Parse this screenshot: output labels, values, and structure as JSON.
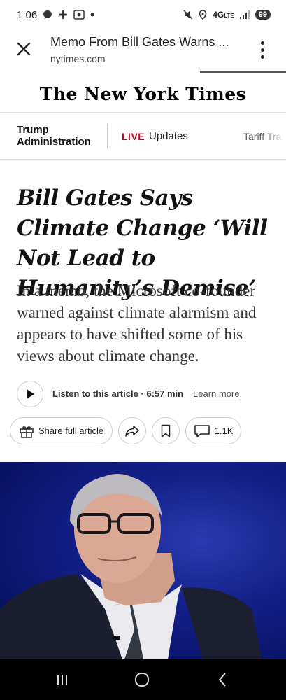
{
  "status_bar": {
    "time": "1:06",
    "network": "4G",
    "network_suffix": "LTE",
    "battery": "99"
  },
  "tab": {
    "title": "Memo From Bill Gates Warns ...",
    "url": "nytimes.com"
  },
  "logo": "The New York Times",
  "section_nav": {
    "topic": "Trump Administration",
    "live_badge": "LIVE",
    "live_label": "Updates",
    "next_item": "Tariff Tra"
  },
  "article": {
    "headline": "Bill Gates Says Climate Change ‘Will Not Lead to Humanity’s Demise’",
    "summary": "In a memo, the Microsoft co-founder warned against climate alarmism and appears to have shifted some of his views about climate change.",
    "listen_label": "Listen to this article · 6:57 min",
    "learn_more": "Learn more",
    "share_label": "Share full article",
    "comment_count": "1.1K"
  },
  "colors": {
    "live_red": "#d0021b",
    "photo_blue": "#13208a"
  }
}
